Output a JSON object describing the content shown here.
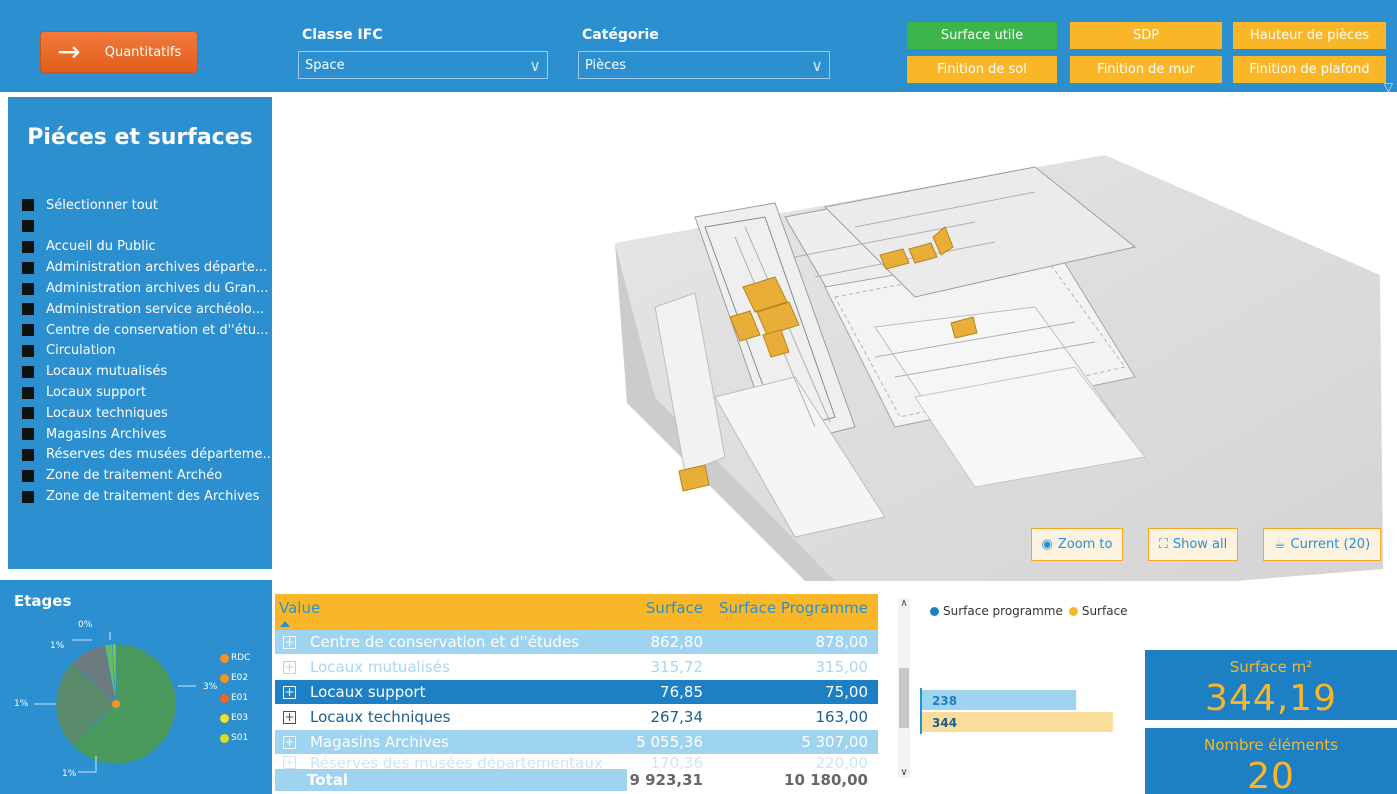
{
  "header": {
    "quant_button": "Quantitatifs",
    "filter1": {
      "label": "Classe IFC",
      "value": "Space"
    },
    "filter2": {
      "label": "Catégorie",
      "value": "Pièces"
    },
    "buttons": [
      {
        "label": "Surface utile",
        "active": true
      },
      {
        "label": "SDP",
        "active": false
      },
      {
        "label": "Hauteur de pièces",
        "active": false
      },
      {
        "label": "Finition de sol",
        "active": false
      },
      {
        "label": "Finition de mur",
        "active": false
      },
      {
        "label": "Finition de plafond",
        "active": false
      }
    ]
  },
  "left_panel": {
    "title": "Piéces et surfaces",
    "items": [
      "Sélectionner tout",
      "",
      "Accueil du Public",
      "Administration archives départe...",
      "Administration archives du Gran...",
      "Administration service archéolo...",
      "Centre de conservation et d''étu...",
      "Circulation",
      "Locaux mutualisés",
      "Locaux support",
      "Locaux techniques",
      "Magasins Archives",
      "Réserves des musées départeme...",
      "Zone de traitement Archéo",
      "Zone de traitement des Archives"
    ]
  },
  "etages": {
    "title": "Etages",
    "legend": [
      {
        "name": "RDC",
        "color": "#F7941D"
      },
      {
        "name": "E02",
        "color": "#F7941D"
      },
      {
        "name": "E01",
        "color": "#F26522"
      },
      {
        "name": "E03",
        "color": "#F4E01E"
      },
      {
        "name": "S01",
        "color": "#D7DF23"
      }
    ],
    "labels": [
      "0%",
      "1%",
      "3%",
      "1%",
      "1%"
    ]
  },
  "viewer": {
    "buttons": [
      {
        "icon": "eye-icon",
        "label": "Zoom to"
      },
      {
        "icon": "expand-icon",
        "label": "Show all"
      },
      {
        "icon": "basket-icon",
        "label": "Current (20)"
      }
    ]
  },
  "table": {
    "headers": [
      "Value",
      "Surface",
      "Surface Programme"
    ],
    "rows": [
      [
        "Centre de conservation et d''études",
        "862,80",
        "878,00"
      ],
      [
        "Locaux mutualisés",
        "315,72",
        "315,00"
      ],
      [
        "Locaux support",
        "76,85",
        "75,00"
      ],
      [
        "Locaux techniques",
        "267,34",
        "163,00"
      ],
      [
        "Magasins Archives",
        "5 055,36",
        "5 307,00"
      ],
      [
        "Réserves des musées départementaux",
        "170,36",
        "220,00"
      ]
    ],
    "total": [
      "Total",
      "9 923,31",
      "10 180,00"
    ]
  },
  "bar_chart": {
    "legend": [
      {
        "name": "Surface programme",
        "color": "#1D7FC4"
      },
      {
        "name": "Surface",
        "color": "#F9B727"
      }
    ]
  },
  "chart_data": [
    {
      "type": "bar",
      "categories": [
        ""
      ],
      "series": [
        {
          "name": "Surface programme",
          "values": [
            238
          ]
        },
        {
          "name": "Surface",
          "values": [
            344
          ]
        }
      ],
      "title": "",
      "xlabel": "",
      "ylabel": "",
      "orientation": "horizontal",
      "xlim": [
        0,
        550
      ],
      "legend": "top-left",
      "grid": false
    },
    {
      "type": "pie",
      "categories": [
        "RDC",
        "E02",
        "E01",
        "E03",
        "S01"
      ],
      "values": [
        63,
        24,
        10,
        2,
        1
      ],
      "colors": [
        "#4A9A5E",
        "#5A8A6A",
        "#6B7B7F",
        "#66BB6A",
        "#8BC34A"
      ],
      "title": "Etages",
      "legend": "right",
      "grid": false
    }
  ],
  "kpi": [
    {
      "label": "Surface m²",
      "value": "344,19"
    },
    {
      "label": "Nombre éléments",
      "value": "20"
    }
  ]
}
